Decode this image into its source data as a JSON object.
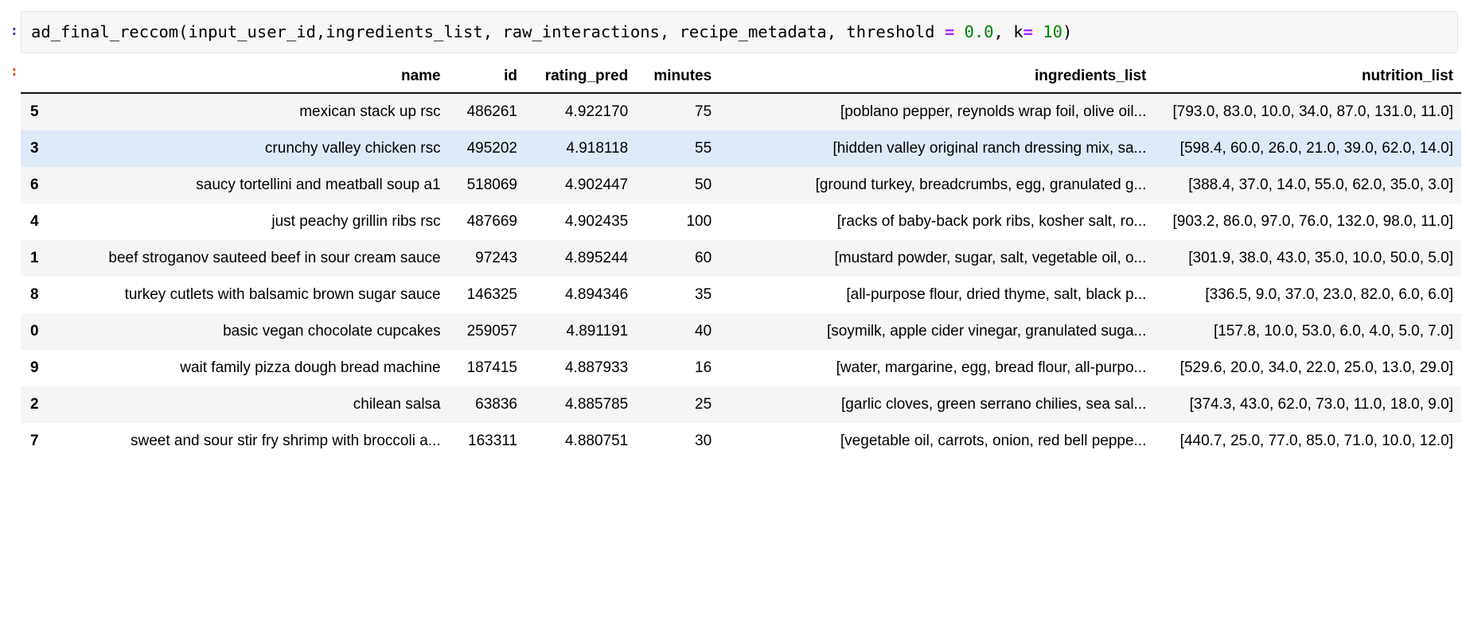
{
  "notebook": {
    "input_prompt": ":",
    "output_prompt": ":",
    "code": {
      "segments": [
        {
          "text": "ad_final_reccom(input_user_id,ingredients_list, raw_interactions, recipe_metadata, threshold ",
          "type": "plain"
        },
        {
          "text": "=",
          "type": "op"
        },
        {
          "text": " ",
          "type": "plain"
        },
        {
          "text": "0.0",
          "type": "num"
        },
        {
          "text": ", k",
          "type": "plain"
        },
        {
          "text": "=",
          "type": "op"
        },
        {
          "text": " ",
          "type": "plain"
        },
        {
          "text": "10",
          "type": "num"
        },
        {
          "text": ")",
          "type": "plain"
        }
      ],
      "full_text": "ad_final_reccom(input_user_id,ingredients_list, raw_interactions, recipe_metadata, threshold = 0.0, k= 10)"
    }
  },
  "colors": {
    "operator": "#aa22ff",
    "number": "#008000",
    "input_prompt": "#303f9f",
    "output_prompt": "#d84315",
    "row_alt": "#f5f5f5",
    "row_highlight": "#dfeaf8",
    "header_rule": "#111111",
    "code_bg": "#f7f7f7"
  },
  "table": {
    "index_header": "",
    "columns": [
      "name",
      "id",
      "rating_pred",
      "minutes",
      "ingredients_list",
      "nutrition_list"
    ],
    "rows": [
      {
        "index": "5",
        "name": "mexican stack up rsc",
        "id": "486261",
        "rating_pred": "4.922170",
        "minutes": "75",
        "ingredients_list": "[poblano pepper, reynolds wrap foil, olive oil...",
        "nutrition_list": "[793.0, 83.0, 10.0, 34.0, 87.0, 131.0, 11.0]",
        "style": "alt"
      },
      {
        "index": "3",
        "name": "crunchy valley chicken rsc",
        "id": "495202",
        "rating_pred": "4.918118",
        "minutes": "55",
        "ingredients_list": "[hidden valley original ranch dressing mix, sa...",
        "nutrition_list": "[598.4, 60.0, 26.0, 21.0, 39.0, 62.0, 14.0]",
        "style": "hl"
      },
      {
        "index": "6",
        "name": "saucy tortellini and meatball soup a1",
        "id": "518069",
        "rating_pred": "4.902447",
        "minutes": "50",
        "ingredients_list": "[ground turkey, breadcrumbs, egg, granulated g...",
        "nutrition_list": "[388.4, 37.0, 14.0, 55.0, 62.0, 35.0, 3.0]",
        "style": "alt"
      },
      {
        "index": "4",
        "name": "just peachy grillin ribs rsc",
        "id": "487669",
        "rating_pred": "4.902435",
        "minutes": "100",
        "ingredients_list": "[racks of baby-back pork ribs, kosher salt, ro...",
        "nutrition_list": "[903.2, 86.0, 97.0, 76.0, 132.0, 98.0, 11.0]",
        "style": "plain"
      },
      {
        "index": "1",
        "name": "beef stroganov sauteed beef in sour cream sauce",
        "id": "97243",
        "rating_pred": "4.895244",
        "minutes": "60",
        "ingredients_list": "[mustard powder, sugar, salt, vegetable oil, o...",
        "nutrition_list": "[301.9, 38.0, 43.0, 35.0, 10.0, 50.0, 5.0]",
        "style": "alt"
      },
      {
        "index": "8",
        "name": "turkey cutlets with balsamic brown sugar sauce",
        "id": "146325",
        "rating_pred": "4.894346",
        "minutes": "35",
        "ingredients_list": "[all-purpose flour, dried thyme, salt, black p...",
        "nutrition_list": "[336.5, 9.0, 37.0, 23.0, 82.0, 6.0, 6.0]",
        "style": "plain"
      },
      {
        "index": "0",
        "name": "basic vegan chocolate cupcakes",
        "id": "259057",
        "rating_pred": "4.891191",
        "minutes": "40",
        "ingredients_list": "[soymilk, apple cider vinegar, granulated suga...",
        "nutrition_list": "[157.8, 10.0, 53.0, 6.0, 4.0, 5.0, 7.0]",
        "style": "alt"
      },
      {
        "index": "9",
        "name": "wait family pizza dough bread machine",
        "id": "187415",
        "rating_pred": "4.887933",
        "minutes": "16",
        "ingredients_list": "[water, margarine, egg, bread flour, all-purpo...",
        "nutrition_list": "[529.6, 20.0, 34.0, 22.0, 25.0, 13.0, 29.0]",
        "style": "plain"
      },
      {
        "index": "2",
        "name": "chilean salsa",
        "id": "63836",
        "rating_pred": "4.885785",
        "minutes": "25",
        "ingredients_list": "[garlic cloves, green serrano chilies, sea sal...",
        "nutrition_list": "[374.3, 43.0, 62.0, 73.0, 11.0, 18.0, 9.0]",
        "style": "alt"
      },
      {
        "index": "7",
        "name": "sweet and sour stir fry shrimp with broccoli a...",
        "id": "163311",
        "rating_pred": "4.880751",
        "minutes": "30",
        "ingredients_list": "[vegetable oil, carrots, onion, red bell peppe...",
        "nutrition_list": "[440.7, 25.0, 77.0, 85.0, 71.0, 10.0, 12.0]",
        "style": "plain"
      }
    ]
  }
}
